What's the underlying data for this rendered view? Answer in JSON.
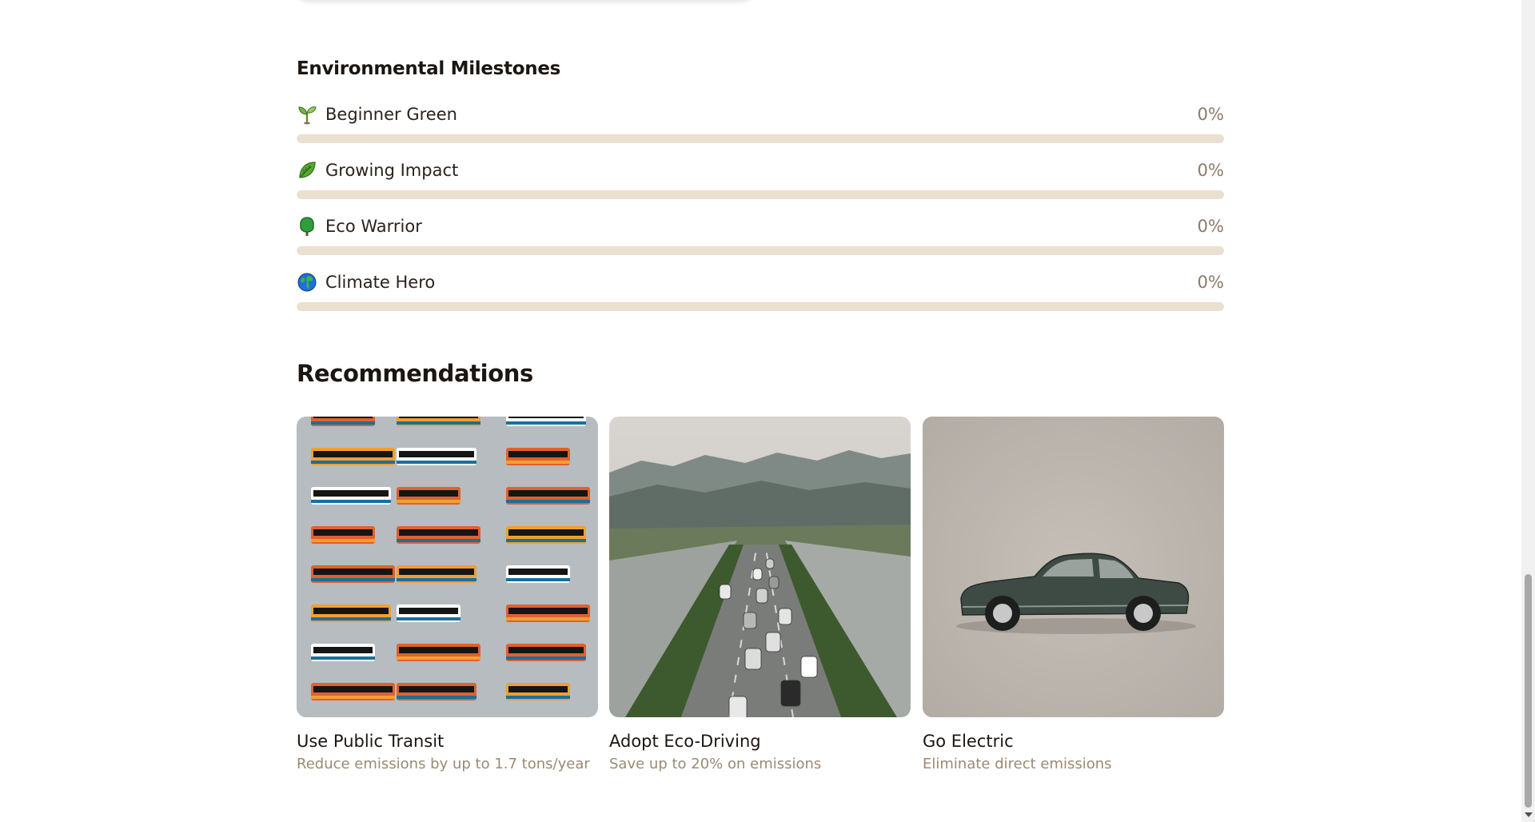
{
  "milestones": {
    "title": "Environmental Milestones",
    "items": [
      {
        "icon": "seedling-icon",
        "label": "Beginner Green",
        "percent_label": "0%",
        "progress": 0
      },
      {
        "icon": "leaf-icon",
        "label": "Growing Impact",
        "percent_label": "0%",
        "progress": 0
      },
      {
        "icon": "tree-icon",
        "label": "Eco Warrior",
        "percent_label": "0%",
        "progress": 0
      },
      {
        "icon": "globe-icon",
        "label": "Climate Hero",
        "percent_label": "0%",
        "progress": 0
      }
    ]
  },
  "recommendations": {
    "title": "Recommendations",
    "cards": [
      {
        "image": "public-transit-image",
        "title": "Use Public Transit",
        "subtitle": "Reduce emissions by up to 1.7 tons/year"
      },
      {
        "image": "highway-traffic-image",
        "title": "Adopt Eco-Driving",
        "subtitle": "Save up to 20% on emissions"
      },
      {
        "image": "electric-car-image",
        "title": "Go Electric",
        "subtitle": "Eliminate direct emissions"
      }
    ]
  },
  "colors": {
    "text_primary": "#1c1612",
    "text_muted": "#9a8a74",
    "track": "#ebe0d0",
    "progress_fill": "#6a9a4a"
  }
}
